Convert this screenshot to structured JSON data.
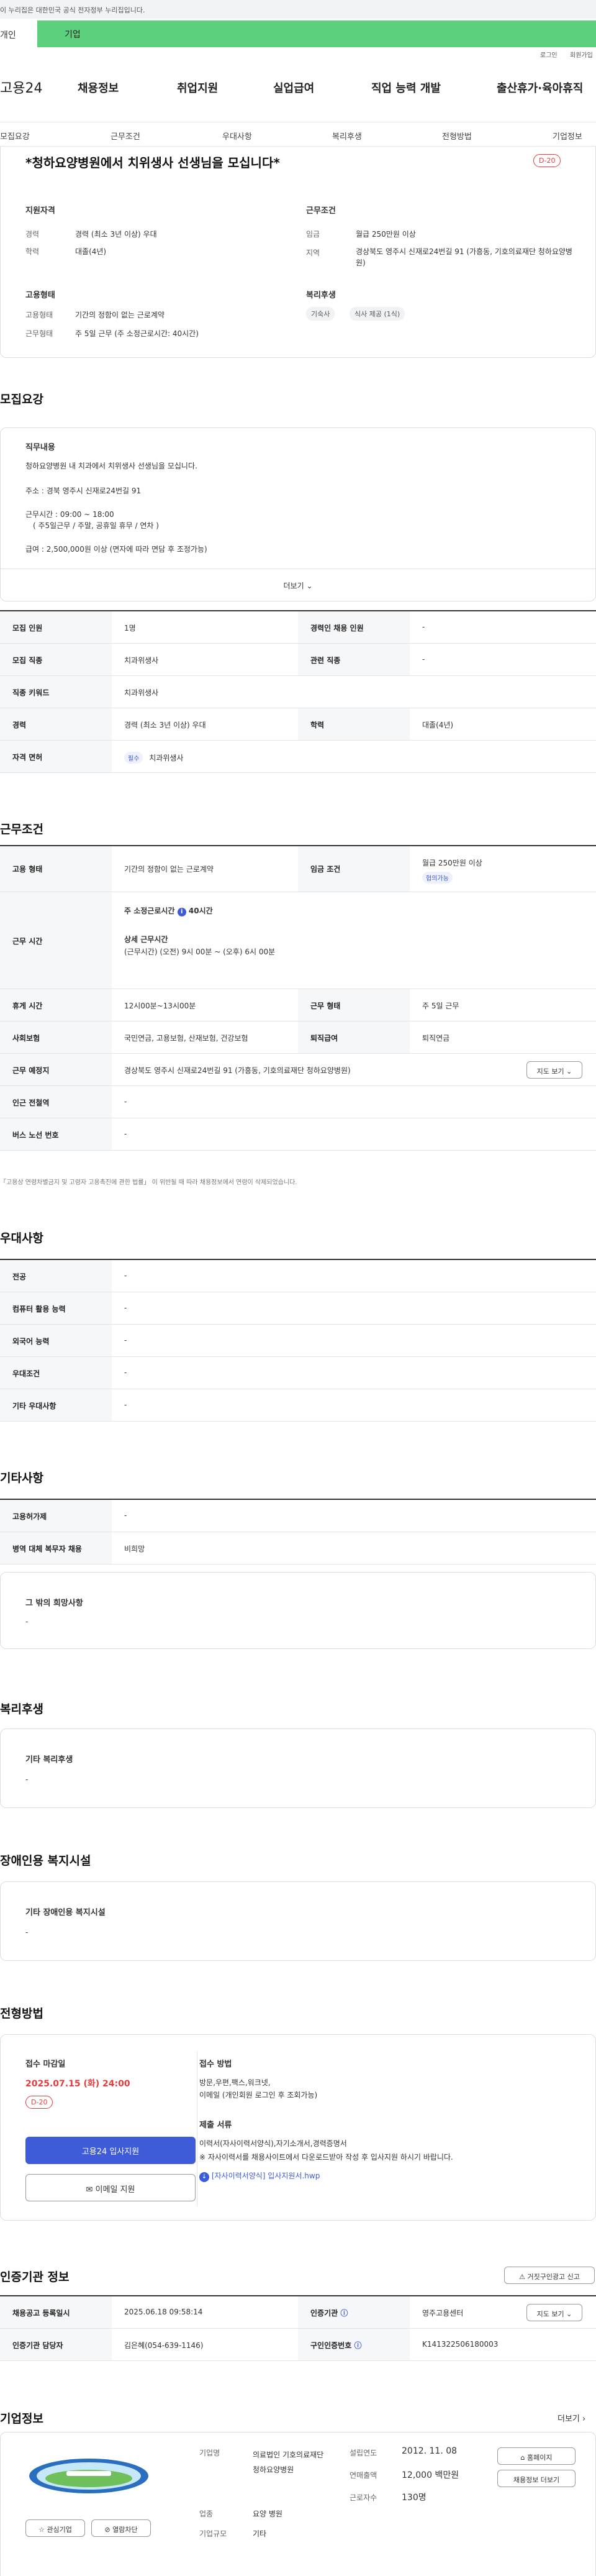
{
  "gov_banner": "이 누리집은 대한민국 공식 전자정부 누리집입니다.",
  "tabs": {
    "individual": "개인",
    "corporate": "기업"
  },
  "util": {
    "login": "로그인",
    "signup": "회원가입"
  },
  "gnb": {
    "logo": "고용24",
    "items": [
      "채용정보",
      "취업지원",
      "실업급여",
      "직업 능력 개발",
      "출산휴가·육아휴직"
    ]
  },
  "subnav": [
    "모집요강",
    "근무조건",
    "우대사항",
    "복리후생",
    "전형방법",
    "기업정보"
  ],
  "header": {
    "title": "*청하요양병원에서 치위생사 선생님을 모십니다*",
    "dday": "D-20",
    "qual_head": "지원자격",
    "career_lab": "경력",
    "career_val": "경력 (최소 3년 이상) 우대",
    "edu_lab": "학력",
    "edu_val": "대졸(4년)",
    "cond_head": "근무조건",
    "wage_lab": "임금",
    "wage_val": "월급 250만원 이상",
    "region_lab": "지역",
    "region_val": "경상북도 영주시 신재로24번길 91 (가흥동, 기호의료재단 청하요양병원)",
    "emp_head": "고용형태",
    "emptype_lab": "고용형태",
    "emptype_val": "기간의 정함이 없는 근로계약",
    "worktype_lab": "근무형태",
    "worktype_val": "주 5일 근무 (주 소정근로시간: 40시간)",
    "welfare_head": "복리후생",
    "welfare_chips": [
      "기숙사",
      "식사 제공 (1식)"
    ]
  },
  "recruit": {
    "title": "모집요강",
    "body_head": "직무내용",
    "lines": [
      "청하요양병원 내 치과에서 치위생사 선생님을 모십니다.",
      "주소 : 경북 영주시 신재로24번길 91",
      "근무시간 :  09:00 ~ 18:00",
      "( 주5일근무 / 주말, 공휴일 휴무 / 연차 )",
      "급여 :  2,500,000원 이상 (면자에 따라 면담 후 조정가능)"
    ],
    "more": "더보기",
    "rows": [
      [
        "모집 인원",
        "1명",
        "경력인 채용 인원",
        "-"
      ],
      [
        "모집 직종",
        "치과위생사",
        "관련 직종",
        "-"
      ],
      [
        "직종 키워드",
        "치과위생사",
        "",
        ""
      ],
      [
        "경력",
        "경력 (최소 3년 이상) 우대",
        "학력",
        "대졸(4년)"
      ]
    ],
    "license_lab": "자격 면허",
    "license_badge": "필수",
    "license_val": "치과위생사"
  },
  "conditions": {
    "title": "근무조건",
    "emp_lab": "고용 형태",
    "emp_val": "기간의 정함이 없는 근로계약",
    "wage_lab": "임금 조건",
    "wage_val": "월급 250만원 이상",
    "wage_badge": "협의가능",
    "time_lab": "근무 시간",
    "time_main": "주 소정근로시간",
    "time_hours": "40시간",
    "time_detail_head": "상세 근무시간",
    "time_detail": "(근무시간) (오전) 9시 00분 ~ (오후) 6시 00분",
    "break_lab": "휴게 시간",
    "break_val": "12시00분~13시00분",
    "form_lab": "근무 형태",
    "form_val": "주 5일 근무",
    "ins_lab": "사회보험",
    "ins_val": "국민연금, 고용보험, 산재보험, 건강보험",
    "sev_lab": "퇴직급여",
    "sev_val": "퇴직연금",
    "loc_lab": "근무 예정지",
    "loc_val": "경상북도 영주시 신재로24번길 91 (가흥동, 기호의료재단 청하요양병원)",
    "map_btn": "지도 보기",
    "subway_lab": "인근 전철역",
    "subway_val": "-",
    "bus_lab": "버스 노선 번호",
    "bus_val": "-",
    "note": "「고용상 연령차별금지 및 고령자 고용촉진에 관한 법률」 이 위반될 때 따라 채용정보에서 연령이 삭제되었습니다."
  },
  "preference": {
    "title": "우대사항",
    "rows": [
      [
        "전공",
        "-"
      ],
      [
        "컴퓨터 활용 능력",
        "-"
      ],
      [
        "외국어 능력",
        "-"
      ],
      [
        "우대조건",
        "-"
      ],
      [
        "기타 우대사항",
        "-"
      ]
    ]
  },
  "others": {
    "title": "기타사항",
    "rows": [
      [
        "고용허가제",
        "-"
      ],
      [
        "병역 대체 복무자 채용",
        "비희망"
      ]
    ],
    "wish_head": "그 밖의 희망사항",
    "wish_val": "-"
  },
  "welfare": {
    "title": "복리후생",
    "head": "기타 복리후생",
    "val": "-"
  },
  "disabled": {
    "title": "장애인용 복지시설",
    "head": "기타 장애인용 복지시설",
    "val": "-"
  },
  "selection": {
    "title": "전형방법",
    "deadline_head": "접수 마감일",
    "deadline": "2025.07.15 (화) 24:00",
    "dday": "D-20",
    "apply_btn": "고용24 입사지원",
    "email_btn": "이메일 지원",
    "method_head": "접수 방법",
    "method_lines": [
      "방문,우편,팩스,워크넷,",
      "이메일 (개인회원 로그인 후 조회가능)"
    ],
    "docs_head": "제출 서류",
    "docs_lines": [
      "이력서(자사이력서양식),자기소개서,경력증명서",
      "※ 자사이력서를 채용사이트에서 다운로드받아 작성 후 입사지원 하시기 바랍니다."
    ],
    "docs_link": "[자사이력서양식] 입사지원서.hwp"
  },
  "cert": {
    "title": "인증기관 정보",
    "report_btn": "거짓구인광고 신고",
    "reg_lab": "채용공고 등록일시",
    "reg_val": "2025.06.18 09:58:14",
    "org_lab": "인증기관",
    "org_val": "영주고용센터",
    "map_btn": "지도 보기",
    "mgr_lab": "인증기관 담당자",
    "mgr_val": "김은혜(054-639-1146)",
    "num_lab": "구인인증번호",
    "num_val": "K141322506180003"
  },
  "company": {
    "title": "기업정보",
    "more": "더보기",
    "fav_btn": "관심기업",
    "block_btn": "열람차단",
    "name_lab": "기업명",
    "name_val": "의료법인 기호의료재단 청하요양병원",
    "type_lab": "업종",
    "type_val": "요양 병원",
    "size_lab": "기업규모",
    "size_val": "기타",
    "est_lab": "설립연도",
    "est_val": "2012. 11. 08",
    "sales_lab": "연매출액",
    "sales_val": "12,000 백만원",
    "emp_lab": "근로자수",
    "emp_val": "130명",
    "home_btn": "홈페이지",
    "jobs_btn": "채용정보 더보기"
  },
  "colors": {
    "accent_green": "#5dd07e",
    "danger": "#e23c3c",
    "primary": "#3e5bd9"
  }
}
